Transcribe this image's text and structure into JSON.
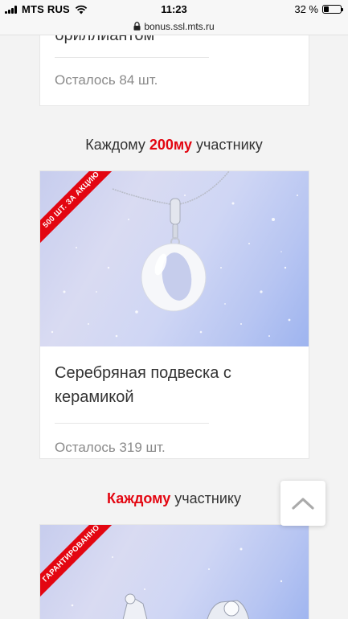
{
  "status_bar": {
    "carrier": "MTS RUS",
    "time": "11:23",
    "battery": "32 %",
    "battery_level": 0.32
  },
  "url_bar": {
    "url": "bonus.ssl.mts.ru"
  },
  "cards": [
    {
      "title": "бриллиантом",
      "remaining": "Осталось 84 шт."
    },
    {
      "heading_prefix": "Каждому ",
      "heading_accent": "200му",
      "heading_suffix": " участнику",
      "ribbon": "500 ШТ. ЗА АКЦИЮ",
      "title_line1": "Серебряная подвеска с",
      "title_line2": "керамикой",
      "remaining": "Осталось 319 шт."
    },
    {
      "heading_accent": "Каждому",
      "heading_suffix": " участнику",
      "ribbon": "ГАРАНТИРОВАННО"
    }
  ],
  "colors": {
    "accent": "#e30611",
    "text": "#333333",
    "muted": "#8a8a8a"
  },
  "icons": {
    "scroll_top": "chevron-up-icon",
    "lock": "lock-icon",
    "wifi": "wifi-icon"
  }
}
